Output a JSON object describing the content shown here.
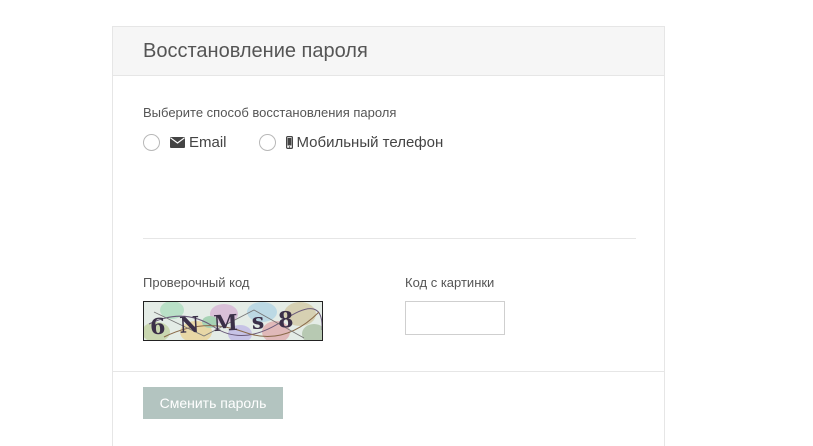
{
  "panel": {
    "title": "Восстановление пароля"
  },
  "recovery": {
    "prompt": "Выберите способ восстановления пароля",
    "options": [
      {
        "label": "Email",
        "icon": "envelope-icon",
        "selected": false
      },
      {
        "label": "Мобильный телефон",
        "icon": "mobile-phone-icon",
        "selected": false
      }
    ]
  },
  "captcha": {
    "label": "Проверочный код",
    "image_text": "6NMs8",
    "input_label": "Код с картинки",
    "input_value": ""
  },
  "actions": {
    "submit_label": "Сменить пароль",
    "submit_color": "#b3c4c0"
  }
}
